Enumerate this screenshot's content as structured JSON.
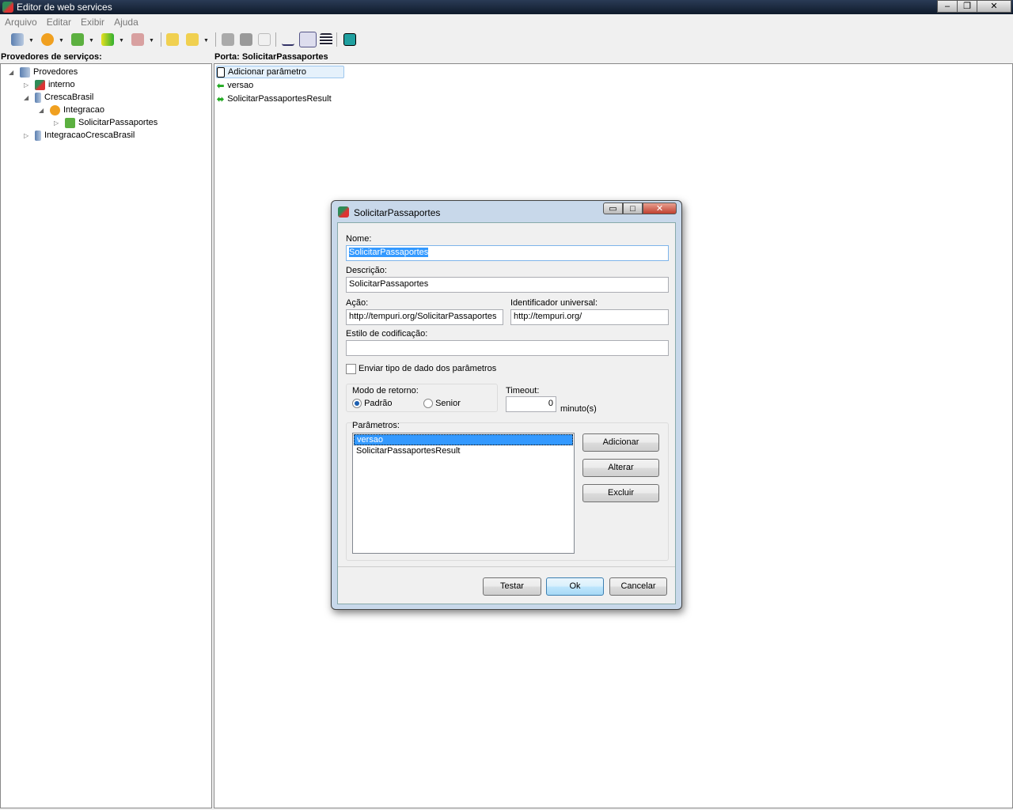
{
  "window": {
    "title": "Editor de web services",
    "buttons": [
      "minimize",
      "restore",
      "close"
    ]
  },
  "menu": [
    "Arquivo",
    "Editar",
    "Exibir",
    "Ajuda"
  ],
  "toolbar": [
    "providers-icon",
    "service-icon",
    "port-icon",
    "parameter-icon",
    "table-icon",
    "import-icon",
    "export-icon",
    "stop-icon",
    "copy-icon",
    "undo-icon",
    "text-view-icon",
    "detail-view-icon",
    "list-view-icon",
    "run-icon"
  ],
  "left": {
    "header": "Provedores de serviços:",
    "tree": [
      {
        "label": "Provedores",
        "level": 0,
        "expanded": true,
        "icon": "server-icon"
      },
      {
        "label": "interno",
        "level": 1,
        "expanded": false,
        "icon": "app-icon"
      },
      {
        "label": "CrescaBrasil",
        "level": 1,
        "expanded": true,
        "icon": "server-icon"
      },
      {
        "label": "Integracao",
        "level": 2,
        "expanded": true,
        "icon": "service-icon"
      },
      {
        "label": "SolicitarPassaportes",
        "level": 3,
        "expanded": false,
        "icon": "port-icon"
      },
      {
        "label": "IntegracaoCrescaBrasil",
        "level": 1,
        "expanded": false,
        "icon": "server-icon"
      }
    ]
  },
  "right": {
    "header": "Porta: SolicitarPassaportes",
    "items": [
      {
        "label": "Adicionar parâmetro",
        "icon": "new-document-icon"
      },
      {
        "label": "versao",
        "icon": "arrow-left-icon"
      },
      {
        "label": "SolicitarPassaportesResult",
        "icon": "arrow-both-icon"
      }
    ]
  },
  "dialog": {
    "title": "SolicitarPassaportes",
    "nome_label": "Nome:",
    "nome": "SolicitarPassaportes",
    "descricao_label": "Descrição:",
    "descricao": "SolicitarPassaportes",
    "acao_label": "Ação:",
    "acao": "http://tempuri.org/SolicitarPassaportes",
    "uri_label": "Identificador universal:",
    "uri": "http://tempuri.org/",
    "estilo_label": "Estilo de codificação:",
    "estilo": "",
    "enviar_label": "Enviar tipo de dado dos parâmetros",
    "modo_label": "Modo de retorno:",
    "padrao": "Padrão",
    "senior": "Senior",
    "timeout_label": "Timeout:",
    "timeout": "0",
    "minutos": "minuto(s)",
    "parametros_label": "Parâmetros:",
    "parametros": [
      "versao",
      "SolicitarPassaportesResult"
    ],
    "adicionar": "Adicionar",
    "alterar": "Alterar",
    "excluir": "Excluir",
    "testar": "Testar",
    "ok": "Ok",
    "cancelar": "Cancelar"
  }
}
